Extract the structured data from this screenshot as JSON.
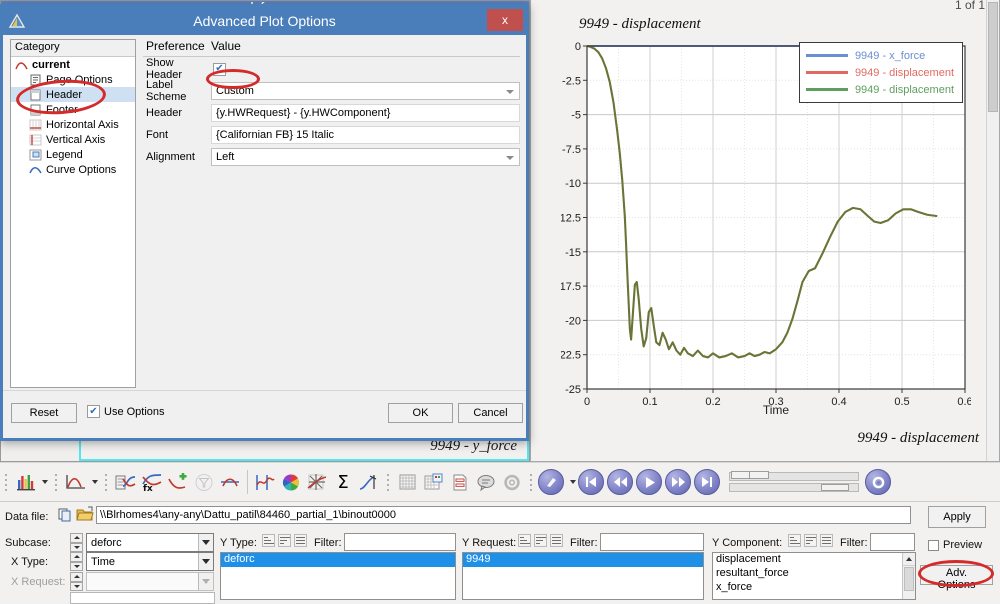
{
  "window": {
    "left_plot_title_partial": "deforc",
    "page_count": "1 of 1"
  },
  "dialog": {
    "title": "Advanced Plot Options",
    "close_label": "x",
    "category_header": "Category",
    "tree": [
      {
        "label": "current",
        "icon": "curve-icon",
        "level": 0,
        "selected": false,
        "bold": true
      },
      {
        "label": "Page Options",
        "icon": "page-icon",
        "level": 1,
        "selected": false,
        "bold": false
      },
      {
        "label": "Header",
        "icon": "header-icon",
        "level": 1,
        "selected": true,
        "bold": false
      },
      {
        "label": "Footer",
        "icon": "footer-icon",
        "level": 1,
        "selected": false,
        "bold": false
      },
      {
        "label": "Horizontal Axis",
        "icon": "h-axis-icon",
        "level": 1,
        "selected": false,
        "bold": false
      },
      {
        "label": "Vertical Axis",
        "icon": "v-axis-icon",
        "level": 1,
        "selected": false,
        "bold": false
      },
      {
        "label": "Legend",
        "icon": "legend-icon",
        "level": 1,
        "selected": false,
        "bold": false
      },
      {
        "label": "Curve Options",
        "icon": "curve-opt-icon",
        "level": 1,
        "selected": false,
        "bold": false
      }
    ],
    "pref_col_header": "Preference",
    "value_col_header": "Value",
    "rows": [
      {
        "label": "Show Header",
        "type": "checkbox",
        "checked": true,
        "value": ""
      },
      {
        "label": "Label Scheme",
        "type": "dropdown",
        "value": "Custom"
      },
      {
        "label": "Header",
        "type": "text",
        "value": "{y.HWRequest} - {y.HWComponent}"
      },
      {
        "label": "Font",
        "type": "text",
        "value": "{Californian FB} 15 Italic"
      },
      {
        "label": "Alignment",
        "type": "dropdown",
        "value": "Left"
      }
    ],
    "reset_label": "Reset",
    "use_options_label": "Use Options",
    "use_options_checked": true,
    "ok_label": "OK",
    "cancel_label": "Cancel"
  },
  "plot": {
    "header": "9949 - displacement",
    "footer": "9949 - displacement",
    "left_footer": "9949 - y_force"
  },
  "chart_data": {
    "type": "line",
    "title": "9949 - displacement",
    "xlabel": "Time",
    "ylabel": "",
    "xlim": [
      0,
      0.6
    ],
    "ylim": [
      -25,
      0
    ],
    "xticks": [
      "0",
      "0.1",
      "0.2",
      "0.3",
      "0.4",
      "0.5",
      "0.6"
    ],
    "yticks": [
      "0",
      "-2.5",
      "-5",
      "-7.5",
      "-10",
      "-12.5",
      "-15",
      "-17.5",
      "-20",
      "-22.5",
      "-25"
    ],
    "grid": true,
    "legend_position": "top-right",
    "legend": [
      {
        "label": "9949 - x_force",
        "color": "#6a8fd0"
      },
      {
        "label": "9949 - displacement",
        "color": "#e06a62"
      },
      {
        "label": "9949 - displacement",
        "color": "#5f9e5f"
      }
    ],
    "series": [
      {
        "name": "9949 - x_force",
        "color": "#6a8fd0",
        "x": [
          0,
          0.1,
          0.2,
          0.3,
          0.4,
          0.5,
          0.56
        ],
        "y": [
          0,
          0,
          0,
          0,
          0,
          0,
          0
        ]
      },
      {
        "name": "9949 - displacement",
        "color": "#6b7436",
        "x": [
          0,
          0.005,
          0.012,
          0.018,
          0.024,
          0.03,
          0.036,
          0.042,
          0.048,
          0.052,
          0.056,
          0.06,
          0.062,
          0.064,
          0.066,
          0.068,
          0.07,
          0.073,
          0.076,
          0.079,
          0.082,
          0.086,
          0.09,
          0.094,
          0.098,
          0.102,
          0.106,
          0.11,
          0.115,
          0.12,
          0.125,
          0.13,
          0.136,
          0.142,
          0.148,
          0.154,
          0.16,
          0.168,
          0.176,
          0.184,
          0.192,
          0.2,
          0.21,
          0.22,
          0.23,
          0.24,
          0.25,
          0.258,
          0.266,
          0.274,
          0.282,
          0.29,
          0.3,
          0.31,
          0.318,
          0.326,
          0.334,
          0.342,
          0.352,
          0.362,
          0.374,
          0.386,
          0.398,
          0.41,
          0.422,
          0.434,
          0.446,
          0.456,
          0.466,
          0.478,
          0.49,
          0.502,
          0.514,
          0.526,
          0.54,
          0.556
        ],
        "y": [
          0,
          -0.05,
          -0.2,
          -0.45,
          -0.9,
          -1.6,
          -2.6,
          -4.1,
          -6.2,
          -7.8,
          -9.8,
          -12.4,
          -14.4,
          -16.6,
          -18.6,
          -20.6,
          -21.4,
          -19.4,
          -17.4,
          -17.2,
          -18.4,
          -20.6,
          -21.9,
          -21.3,
          -19.4,
          -19.1,
          -20.4,
          -21.6,
          -21.8,
          -20.9,
          -21.4,
          -22.1,
          -21.6,
          -22.2,
          -22.5,
          -22.0,
          -22.4,
          -22.6,
          -22.2,
          -22.6,
          -22.7,
          -22.4,
          -22.7,
          -22.6,
          -22.4,
          -22.7,
          -22.6,
          -22.4,
          -22.6,
          -22.5,
          -22.3,
          -22.4,
          -22.1,
          -21.6,
          -20.9,
          -19.9,
          -18.6,
          -17.2,
          -16.4,
          -16.2,
          -15.1,
          -13.9,
          -12.8,
          -12.1,
          -11.8,
          -11.9,
          -12.4,
          -12.8,
          -12.9,
          -12.7,
          -12.2,
          -11.9,
          -11.9,
          -12.1,
          -12.3,
          -12.4
        ]
      }
    ]
  },
  "toolbar": {
    "buttons": [
      {
        "name": "build-plots-icon",
        "glyph": "bar-chart"
      },
      {
        "name": "new-plot-icon",
        "glyph": "curve"
      },
      {
        "name": "define-curves-icon",
        "glyph": "define"
      },
      {
        "name": "math-curve-icon",
        "glyph": "fx"
      },
      {
        "name": "add-curve-icon",
        "glyph": "plus-curve"
      },
      {
        "name": "filter-curve-icon",
        "glyph": "filter"
      },
      {
        "name": "cross-plot-icon",
        "glyph": "crossplot"
      },
      {
        "name": "curve-edit-icon",
        "glyph": "curve-edit"
      },
      {
        "name": "color-wheel-icon",
        "glyph": "colorwheel"
      },
      {
        "name": "axis-star-icon",
        "glyph": "star"
      },
      {
        "name": "sum-icon",
        "glyph": "sigma"
      },
      {
        "name": "vector-icon",
        "glyph": "vector"
      },
      {
        "name": "grid-icon",
        "glyph": "grid"
      },
      {
        "name": "grid-note-icon",
        "glyph": "grid-note"
      },
      {
        "name": "note-icon",
        "glyph": "note"
      },
      {
        "name": "comment-icon",
        "glyph": "comment"
      },
      {
        "name": "settings-icon",
        "glyph": "gear"
      }
    ],
    "animation": [
      {
        "name": "anim-mode-icon",
        "glyph": "pen"
      },
      {
        "name": "first-frame-button",
        "glyph": "first"
      },
      {
        "name": "rewind-button",
        "glyph": "rewind"
      },
      {
        "name": "play-button",
        "glyph": "play"
      },
      {
        "name": "forward-button",
        "glyph": "forward"
      },
      {
        "name": "last-frame-button",
        "glyph": "last"
      },
      {
        "name": "anim-settings-button",
        "glyph": "gear"
      }
    ]
  },
  "datapanel": {
    "data_file_label": "Data file:",
    "data_file_value": "\\\\Blrhomes4\\any-any\\Dattu_patil\\84460_partial_1\\binout0000",
    "subcase_label": "Subcase:",
    "subcase_value": "deforc",
    "x_type_label": "X Type:",
    "x_type_value": "Time",
    "x_request_label": "X Request:",
    "x_request_value": "",
    "y_type_label": "Y Type:",
    "y_type_filter_label": "Filter:",
    "y_type_filter_value": "",
    "y_type_items": [
      {
        "label": "deforc",
        "selected": true
      }
    ],
    "y_request_label": "Y Request:",
    "y_request_filter_label": "Filter:",
    "y_request_filter_value": "",
    "y_request_items": [
      {
        "label": "9949",
        "selected": true
      }
    ],
    "y_component_label": "Y Component:",
    "y_component_filter_label": "Filter:",
    "y_component_filter_value": "",
    "y_component_items": [
      {
        "label": "displacement",
        "selected": false
      },
      {
        "label": "resultant_force",
        "selected": false
      },
      {
        "label": "x_force",
        "selected": false
      }
    ],
    "apply_label": "Apply",
    "preview_label": "Preview",
    "preview_checked": false,
    "adv_options_label": "Adv. Options"
  }
}
